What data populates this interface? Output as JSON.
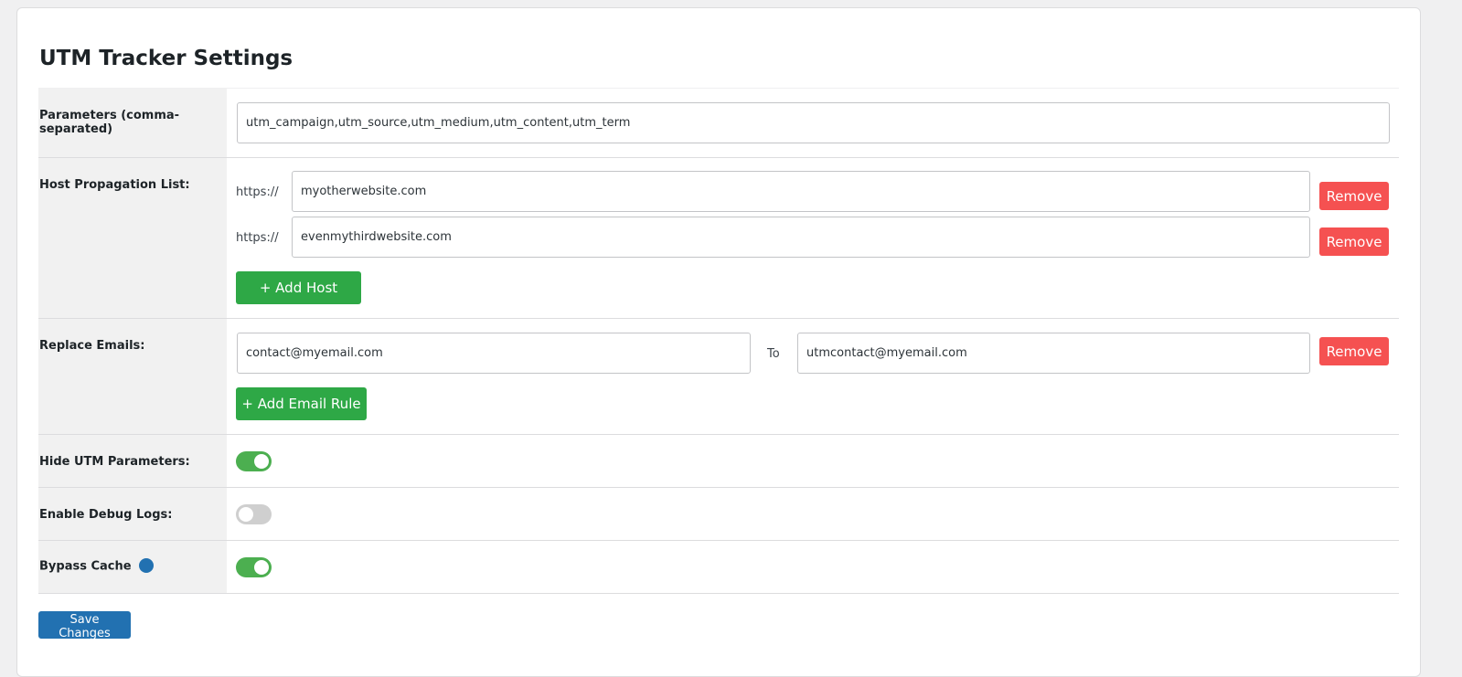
{
  "page": {
    "title": "UTM Tracker Settings"
  },
  "parameters": {
    "label": "Parameters (comma-separated)",
    "value": "utm_campaign,utm_source,utm_medium,utm_content,utm_term"
  },
  "hosts": {
    "label": "Host Propagation List:",
    "prefix": "https://",
    "items": [
      {
        "value": "myotherwebsite.com",
        "remove_label": "Remove"
      },
      {
        "value": "evenmythirdwebsite.com",
        "remove_label": "Remove"
      }
    ],
    "add_label": "+ Add Host"
  },
  "emails": {
    "label": "Replace Emails:",
    "rules": [
      {
        "from": "contact@myemail.com",
        "to_label": "To",
        "to": "utmcontact@myemail.com",
        "remove_label": "Remove"
      }
    ],
    "add_label": "+ Add Email Rule"
  },
  "toggles": {
    "hide_utm": {
      "label": "Hide UTM Parameters:",
      "enabled": true
    },
    "debug_logs": {
      "label": "Enable Debug Logs:",
      "enabled": false
    },
    "bypass_cache": {
      "label": "Bypass Cache",
      "enabled": true
    }
  },
  "actions": {
    "save_label": "Save Changes"
  },
  "colors": {
    "remove": "#f55151",
    "add": "#2ea846",
    "toggle_on": "#4caf50",
    "toggle_off": "#cfcfcf",
    "primary": "#2271b1",
    "info": "#2271b1"
  }
}
